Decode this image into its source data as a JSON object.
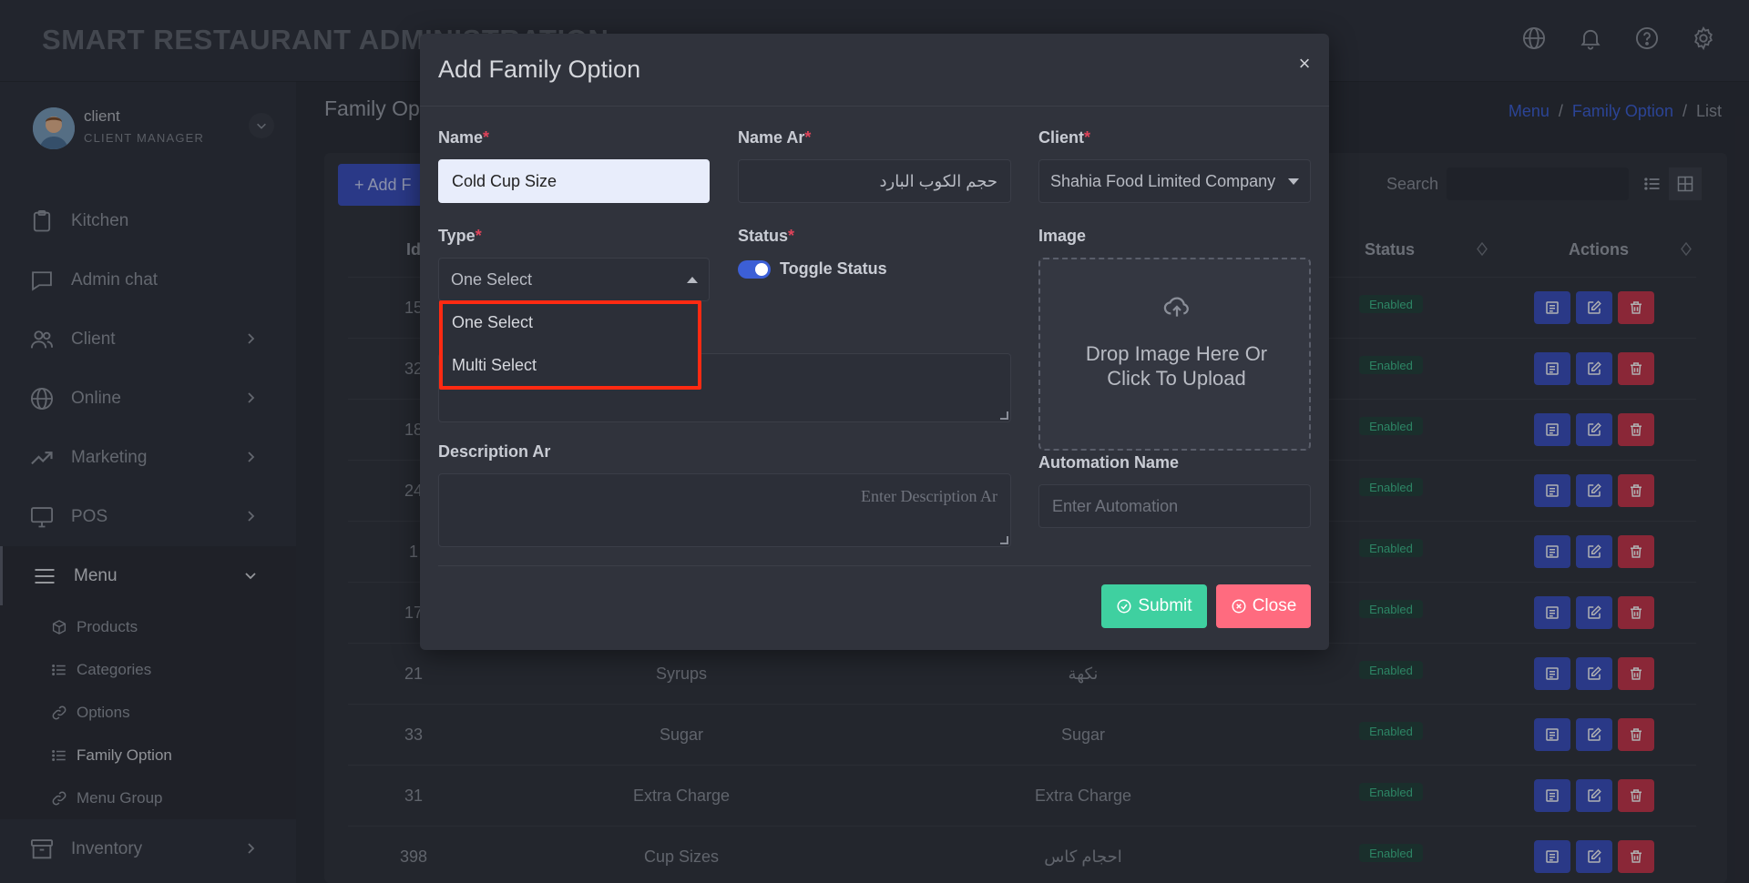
{
  "app": {
    "title": "SMART RESTAURANT ADMINISTRATION"
  },
  "header_icons": [
    "globe-icon",
    "bell-icon",
    "help-icon",
    "gear-icon"
  ],
  "user": {
    "name": "client",
    "role": "CLIENT MANAGER"
  },
  "sidebar": {
    "items": [
      {
        "label": "Kitchen",
        "icon": "clipboard-icon",
        "has_chevron": false
      },
      {
        "label": "Admin chat",
        "icon": "chat-icon",
        "has_chevron": false
      },
      {
        "label": "Client",
        "icon": "users-icon",
        "has_chevron": true
      },
      {
        "label": "Online",
        "icon": "globe-icon",
        "has_chevron": true
      },
      {
        "label": "Marketing",
        "icon": "trending-icon",
        "has_chevron": true
      },
      {
        "label": "POS",
        "icon": "monitor-icon",
        "has_chevron": true
      },
      {
        "label": "Menu",
        "icon": "menu-icon",
        "has_chevron": true,
        "expanded": true
      },
      {
        "label": "Inventory",
        "icon": "archive-icon",
        "has_chevron": true
      }
    ],
    "menu_sub": [
      {
        "label": "Products",
        "icon": "box-icon"
      },
      {
        "label": "Categories",
        "icon": "list-icon"
      },
      {
        "label": "Options",
        "icon": "link-icon"
      },
      {
        "label": "Family Option",
        "icon": "list-icon",
        "active": true
      },
      {
        "label": "Menu Group",
        "icon": "link-icon"
      }
    ]
  },
  "page": {
    "title": "Family Op",
    "breadcrumb": [
      "Menu",
      "/",
      "Family Option",
      "/",
      "List"
    ],
    "add_button": "+ Add F",
    "search_label": "Search"
  },
  "table": {
    "headers": {
      "id": "Id",
      "status": "Status",
      "actions": "Actions"
    },
    "rows": [
      {
        "id": "15",
        "name": "",
        "name_ar": "",
        "status": "Enabled"
      },
      {
        "id": "32",
        "name": "",
        "name_ar": "",
        "status": "Enabled"
      },
      {
        "id": "18",
        "name": "",
        "name_ar": "",
        "status": "Enabled"
      },
      {
        "id": "24",
        "name": "",
        "name_ar": "",
        "status": "Enabled"
      },
      {
        "id": "1",
        "name": "",
        "name_ar": "",
        "status": "Enabled"
      },
      {
        "id": "17",
        "name": "",
        "name_ar": "",
        "status": "Enabled"
      },
      {
        "id": "21",
        "name": "Syrups",
        "name_ar": "نكهة",
        "status": "Enabled"
      },
      {
        "id": "33",
        "name": "Sugar",
        "name_ar": "Sugar",
        "status": "Enabled"
      },
      {
        "id": "31",
        "name": "Extra Charge",
        "name_ar": "Extra Charge",
        "status": "Enabled"
      },
      {
        "id": "398",
        "name": "Cup Sizes",
        "name_ar": "احجام كاس",
        "status": "Enabled"
      }
    ]
  },
  "modal": {
    "title": "Add Family Option",
    "close_glyph": "×",
    "fields": {
      "name": {
        "label": "Name",
        "value": "Cold Cup Size"
      },
      "name_ar": {
        "label": "Name Ar",
        "value": "حجم الكوب البارد"
      },
      "client": {
        "label": "Client",
        "value": "Shahia Food Limited Company"
      },
      "type": {
        "label": "Type",
        "value": "One Select",
        "options": [
          "One Select",
          "Multi Select"
        ]
      },
      "status": {
        "label": "Status",
        "toggle_label": "Toggle Status",
        "on": true
      },
      "image": {
        "label": "Image",
        "dropzone_line1": "Drop Image Here Or",
        "dropzone_line2": "Click To Upload"
      },
      "description_ar": {
        "label": "Description Ar",
        "placeholder": "Enter Description Ar"
      },
      "automation": {
        "label": "Automation Name",
        "placeholder": "Enter Automation"
      }
    },
    "required_mark": "*",
    "buttons": {
      "submit": "Submit",
      "close": "Close"
    }
  },
  "colors": {
    "accent": "#3c5fd6",
    "submit": "#3fd0a0",
    "close": "#ff6b7f",
    "highlight": "#ff2a12",
    "enabled": "#3fbf8e"
  }
}
